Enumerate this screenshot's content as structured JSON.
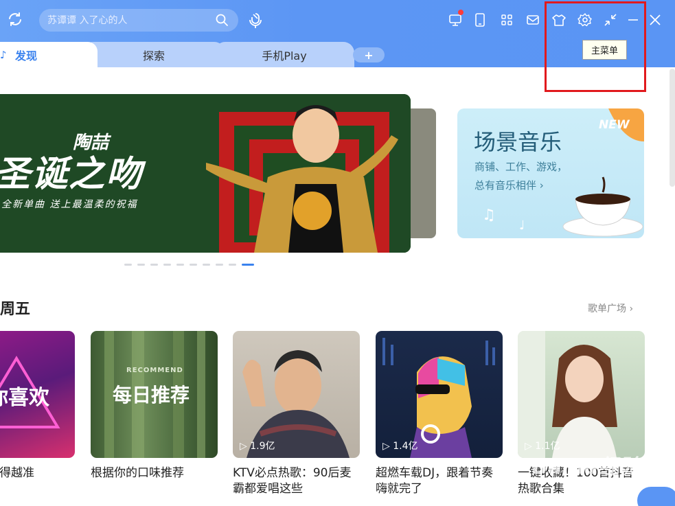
{
  "search": {
    "placeholder": "苏谭谭 入了心的人"
  },
  "tooltip": {
    "text": "主菜单"
  },
  "tabs": [
    {
      "label": "发现",
      "active": true
    },
    {
      "label": "探索",
      "active": false
    },
    {
      "label": "手机Play",
      "active": false
    }
  ],
  "tab_add": {
    "label": "+"
  },
  "banner": {
    "artist": "陶喆",
    "title": "圣诞之吻",
    "subtitle": "全新单曲  送上最温柔的祝福"
  },
  "scene": {
    "title": "场景音乐",
    "desc_line1": "商铺、工作、游戏，",
    "desc_line2": "总有音乐相伴 ›",
    "badge": "NEW"
  },
  "carousel": {
    "count": 10,
    "active_index": 9
  },
  "section": {
    "title": "周五",
    "more_label": "歌单广场 ›"
  },
  "playlists": [
    {
      "image_text": "你喜欢",
      "title": "猜得越准",
      "play_count": ""
    },
    {
      "image_text": "每日推荐",
      "image_subtext": "RECOMMEND",
      "title": "根据你的口味推荐",
      "play_count": ""
    },
    {
      "image_text": "",
      "title": "KTV必点热歌：90后麦霸都爱唱这些",
      "play_count": "1.9亿"
    },
    {
      "image_text": "",
      "title": "超燃车载DJ，跟着节奏嗨就完了",
      "play_count": "1.4亿"
    },
    {
      "image_text": "",
      "title": "一键收藏！100首抖音热歌合集",
      "play_count": "1.1亿"
    }
  ],
  "watermark": "Baidu经验",
  "colors": {
    "accent": "#3a82ee",
    "topbar": "#5c96f4",
    "highlight": "#e1191d"
  }
}
